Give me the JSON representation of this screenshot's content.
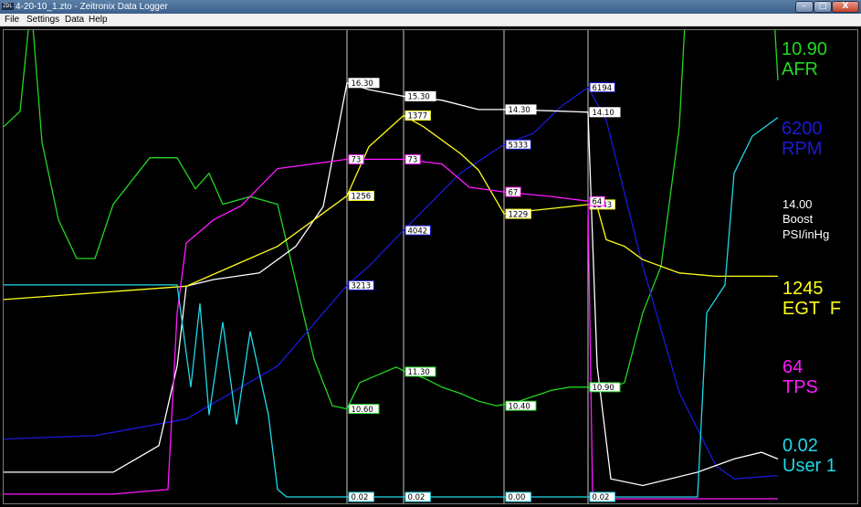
{
  "window": {
    "icon_text": "ZDL",
    "title": "4-20-10_1.zto - Zeitronix Data Logger",
    "minimize_label": "–",
    "maximize_label": "□",
    "close_label": "X"
  },
  "menu": [
    "File",
    "Settings",
    "Data",
    "Help"
  ],
  "readouts": {
    "afr": {
      "value": "10.90",
      "label": "AFR",
      "color": "#22d722"
    },
    "rpm": {
      "value": "6200",
      "label": "RPM",
      "color": "#1a1ad6"
    },
    "boost": {
      "value": "14.00",
      "label": "Boost",
      "label2": "PSI/inHg",
      "color": "#ffffff"
    },
    "egt": {
      "value": "1245",
      "label": "EGT  F",
      "color": "#ffff1a"
    },
    "tps": {
      "value": "64",
      "label": "TPS",
      "color": "#ff1aff"
    },
    "user1": {
      "value": "0.02",
      "label": "User 1",
      "color": "#22d8e8"
    }
  },
  "chart_data": {
    "type": "line",
    "x_range": [
      0,
      1000
    ],
    "series": [
      {
        "name": "AFR",
        "color": "#22d722",
        "y_range": [
          9,
          12
        ],
        "points": [
          [
            0,
            11.4
          ],
          [
            18,
            11.5
          ],
          [
            30,
            12.2
          ],
          [
            42,
            11.3
          ],
          [
            60,
            10.8
          ],
          [
            80,
            10.55
          ],
          [
            100,
            10.55
          ],
          [
            120,
            10.9
          ],
          [
            160,
            11.2
          ],
          [
            190,
            11.2
          ],
          [
            210,
            11.0
          ],
          [
            225,
            11.1
          ],
          [
            240,
            10.9
          ],
          [
            270,
            10.95
          ],
          [
            300,
            10.9
          ],
          [
            320,
            10.4
          ],
          [
            340,
            9.9
          ],
          [
            360,
            9.6
          ],
          [
            376,
            9.58
          ],
          [
            390,
            9.75
          ],
          [
            410,
            9.8
          ],
          [
            430,
            9.85
          ],
          [
            440,
            9.82
          ],
          [
            460,
            9.78
          ],
          [
            480,
            9.72
          ],
          [
            500,
            9.68
          ],
          [
            520,
            9.63
          ],
          [
            540,
            9.6
          ],
          [
            560,
            9.62
          ],
          [
            580,
            9.66
          ],
          [
            600,
            9.7
          ],
          [
            620,
            9.72
          ],
          [
            640,
            9.72
          ],
          [
            660,
            9.7
          ],
          [
            680,
            9.75
          ],
          [
            700,
            10.2
          ],
          [
            720,
            10.5
          ],
          [
            740,
            11.4
          ],
          [
            750,
            12.5
          ],
          [
            800,
            12.5
          ],
          [
            840,
            12.5
          ],
          [
            848,
            11.7
          ]
        ]
      },
      {
        "name": "RPM",
        "color": "#1a1ad6",
        "y_range": [
          0,
          7000
        ],
        "points": [
          [
            0,
            900
          ],
          [
            100,
            950
          ],
          [
            200,
            1200
          ],
          [
            300,
            2000
          ],
          [
            376,
            3213
          ],
          [
            400,
            3500
          ],
          [
            438,
            4042
          ],
          [
            500,
            4900
          ],
          [
            548,
            5333
          ],
          [
            580,
            5500
          ],
          [
            610,
            5900
          ],
          [
            640,
            6194
          ],
          [
            660,
            5700
          ],
          [
            700,
            3500
          ],
          [
            740,
            1600
          ],
          [
            780,
            500
          ],
          [
            800,
            300
          ],
          [
            848,
            350
          ]
        ]
      },
      {
        "name": "Boost",
        "color": "#ffffff",
        "y_range": [
          -15,
          20
        ],
        "points": [
          [
            0,
            -13
          ],
          [
            60,
            -13
          ],
          [
            120,
            -13
          ],
          [
            170,
            -11
          ],
          [
            190,
            -5
          ],
          [
            200,
            1
          ],
          [
            230,
            1.5
          ],
          [
            280,
            2
          ],
          [
            320,
            4
          ],
          [
            350,
            7
          ],
          [
            376,
            16.3
          ],
          [
            400,
            15.8
          ],
          [
            438,
            15.3
          ],
          [
            480,
            15.0
          ],
          [
            520,
            14.3
          ],
          [
            548,
            14.3
          ],
          [
            600,
            14.2
          ],
          [
            640,
            14.1
          ],
          [
            650,
            -5
          ],
          [
            665,
            -13.5
          ],
          [
            700,
            -14
          ],
          [
            760,
            -13
          ],
          [
            800,
            -12
          ],
          [
            830,
            -11.5
          ],
          [
            848,
            -12
          ]
        ]
      },
      {
        "name": "EGT F",
        "color": "#ffff1a",
        "y_range": [
          800,
          1500
        ],
        "points": [
          [
            0,
            1100
          ],
          [
            100,
            1110
          ],
          [
            200,
            1120
          ],
          [
            250,
            1150
          ],
          [
            300,
            1180
          ],
          [
            350,
            1230
          ],
          [
            376,
            1256
          ],
          [
            400,
            1330
          ],
          [
            438,
            1377
          ],
          [
            460,
            1360
          ],
          [
            500,
            1320
          ],
          [
            520,
            1295
          ],
          [
            548,
            1229
          ],
          [
            580,
            1234
          ],
          [
            620,
            1240
          ],
          [
            640,
            1243
          ],
          [
            650,
            1240
          ],
          [
            660,
            1190
          ],
          [
            680,
            1180
          ],
          [
            700,
            1160
          ],
          [
            740,
            1140
          ],
          [
            780,
            1135
          ],
          [
            848,
            1135
          ]
        ]
      },
      {
        "name": "TPS",
        "color": "#ff1aff",
        "y_range": [
          0,
          100
        ],
        "points": [
          [
            0,
            1
          ],
          [
            120,
            1
          ],
          [
            180,
            2
          ],
          [
            190,
            40
          ],
          [
            200,
            55
          ],
          [
            230,
            60
          ],
          [
            260,
            63
          ],
          [
            300,
            71
          ],
          [
            376,
            73
          ],
          [
            438,
            73
          ],
          [
            480,
            72
          ],
          [
            510,
            67
          ],
          [
            548,
            66
          ],
          [
            600,
            65
          ],
          [
            640,
            64
          ],
          [
            645,
            1
          ],
          [
            660,
            0
          ],
          [
            700,
            0
          ],
          [
            848,
            0
          ]
        ]
      },
      {
        "name": "User 1",
        "color": "#22d8e8",
        "y_range": [
          0,
          5
        ],
        "points": [
          [
            0,
            2.3
          ],
          [
            150,
            2.3
          ],
          [
            190,
            2.3
          ],
          [
            205,
            1.2
          ],
          [
            215,
            2.1
          ],
          [
            225,
            0.9
          ],
          [
            240,
            1.9
          ],
          [
            255,
            0.8
          ],
          [
            270,
            1.8
          ],
          [
            290,
            0.9
          ],
          [
            300,
            0.1
          ],
          [
            310,
            0.02
          ],
          [
            376,
            0.02
          ],
          [
            640,
            0.02
          ],
          [
            700,
            0.02
          ],
          [
            760,
            0.02
          ],
          [
            770,
            2.0
          ],
          [
            790,
            2.3
          ],
          [
            800,
            3.5
          ],
          [
            820,
            3.9
          ],
          [
            848,
            4.1
          ]
        ]
      }
    ],
    "cursors": [
      {
        "x": 376,
        "labels": [
          {
            "text": "16.30",
            "series": "Boost",
            "y": 16.3
          },
          {
            "text": "1256",
            "series": "EGT F",
            "y": 1256
          },
          {
            "text": "73",
            "series": "TPS",
            "y": 73
          },
          {
            "text": "3213",
            "series": "RPM",
            "y": 3213
          },
          {
            "text": "10.60",
            "series": "AFR",
            "y": 9.58
          },
          {
            "text": "0.02",
            "series": "User 1",
            "y": 0.02
          }
        ]
      },
      {
        "x": 438,
        "labels": [
          {
            "text": "1377",
            "series": "EGT F",
            "y": 1377
          },
          {
            "text": "73",
            "series": "TPS",
            "y": 73
          },
          {
            "text": "15.30",
            "series": "Boost",
            "y": 15.3
          },
          {
            "text": "4042",
            "series": "RPM",
            "y": 4042
          },
          {
            "text": "11.30",
            "series": "AFR",
            "y": 9.82
          },
          {
            "text": "0.02",
            "series": "User 1",
            "y": 0.02
          }
        ]
      },
      {
        "x": 548,
        "labels": [
          {
            "text": "1229",
            "series": "EGT F",
            "y": 1229
          },
          {
            "text": "67",
            "series": "TPS",
            "y": 66
          },
          {
            "text": "5333",
            "series": "RPM",
            "y": 5333
          },
          {
            "text": "14.30",
            "series": "Boost",
            "y": 14.3
          },
          {
            "text": "10.40",
            "series": "AFR",
            "y": 9.6
          },
          {
            "text": "0.00",
            "series": "User 1",
            "y": 0.02
          }
        ]
      },
      {
        "x": 640,
        "labels": [
          {
            "text": "6194",
            "series": "RPM",
            "y": 6194
          },
          {
            "text": "1243",
            "series": "EGT F",
            "y": 1243
          },
          {
            "text": "14.10",
            "series": "Boost",
            "y": 14.1
          },
          {
            "text": "64",
            "series": "TPS",
            "y": 64
          },
          {
            "text": "10.90",
            "series": "AFR",
            "y": 9.72
          },
          {
            "text": "0.02",
            "series": "User 1",
            "y": 0.02
          }
        ]
      }
    ]
  }
}
